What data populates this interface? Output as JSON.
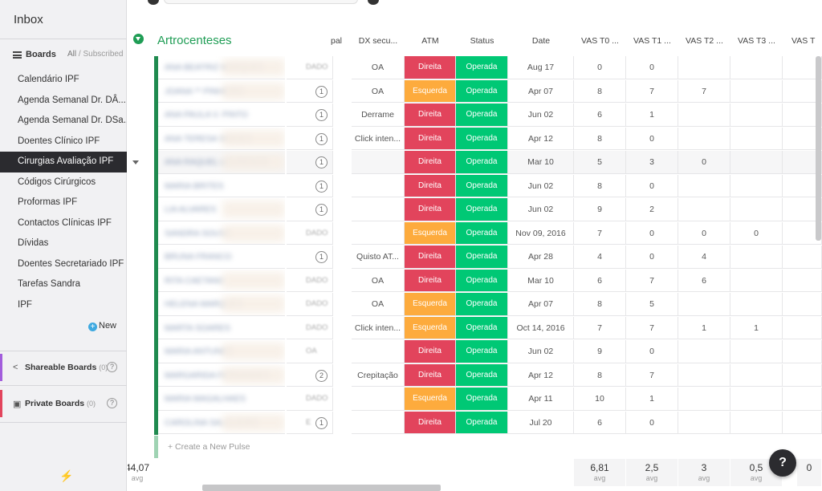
{
  "sidebar": {
    "inbox": "Inbox",
    "boards_label": "Boards",
    "filter_all": "All",
    "filter_sep": " / ",
    "filter_subscribed": "Subscribed",
    "items": [
      "Calendário IPF",
      "Agenda Semanal Dr. DÂ...",
      "Agenda Semanal Dr. DSa...",
      "Doentes Clínico IPF",
      "Cirurgias Avaliação IPF",
      "Códigos Cirúrgicos",
      "Proformas IPF",
      "Contactos Clínicas IPF",
      "Dívidas",
      "Doentes Secretariado IPF",
      "Tarefas Sandra",
      "IPF"
    ],
    "active_index": 4,
    "new_label": "New",
    "shareable": {
      "label": "Shareable Boards",
      "count": "(0)",
      "help": "?"
    },
    "private": {
      "label": "Private Boards",
      "count": "(0)",
      "help": "?"
    },
    "icons": {
      "menu": "menu-icon",
      "share": "share-icon",
      "lock": "lock-icon",
      "bolt": "bolt-icon",
      "plus": "plus-icon"
    }
  },
  "group": {
    "title": "Artrocenteses",
    "color": "#1f9d55"
  },
  "columns": {
    "partial": "pal",
    "dx": "DX secu...",
    "atm": "ATM",
    "status": "Status",
    "date": "Date",
    "vas0": "VAS T0 ...",
    "vas1": "VAS T1 ...",
    "vas2": "VAS T2 ...",
    "vas3": "VAS T3 ...",
    "vas4": "VAS T"
  },
  "rows": [
    {
      "name": "ANA BEATRIZ MARQUES",
      "partial": "DADO",
      "updates": "",
      "dx": "OA",
      "atm": "Direita",
      "status": "Operada",
      "date": "Aug 17",
      "v0": "0",
      "v1": "0",
      "v2": "",
      "v3": ""
    },
    {
      "name": "JOANA ** PINHEIRO",
      "partial": "",
      "updates": "1",
      "dx": "OA",
      "atm": "Esquerda",
      "status": "Operada",
      "date": "Apr 07",
      "v0": "8",
      "v1": "7",
      "v2": "7",
      "v3": ""
    },
    {
      "name": "ANA PAULA V. PINTO",
      "partial": "",
      "updates": "1",
      "dx": "Derrame",
      "atm": "Direita",
      "status": "Operada",
      "date": "Jun 02",
      "v0": "6",
      "v1": "1",
      "v2": "",
      "v3": ""
    },
    {
      "name": "ANA TERESA SIMOES",
      "partial": "",
      "updates": "1",
      "dx": "Click inten...",
      "atm": "Direita",
      "status": "Operada",
      "date": "Apr 12",
      "v0": "8",
      "v1": "0",
      "v2": "",
      "v3": ""
    },
    {
      "name": "ANA RAQUEL LOURENCO",
      "partial": "",
      "updates": "1",
      "dx": "",
      "atm": "Direita",
      "status": "Operada",
      "date": "Mar 10",
      "v0": "5",
      "v1": "3",
      "v2": "0",
      "v3": ""
    },
    {
      "name": "MARIA BRITES",
      "partial": "",
      "updates": "1",
      "dx": "",
      "atm": "Direita",
      "status": "Operada",
      "date": "Jun 02",
      "v0": "8",
      "v1": "0",
      "v2": "",
      "v3": ""
    },
    {
      "name": "LIA ALVARES",
      "partial": "",
      "updates": "1",
      "dx": "",
      "atm": "Direita",
      "status": "Operada",
      "date": "Jun 02",
      "v0": "9",
      "v1": "2",
      "v2": "",
      "v3": ""
    },
    {
      "name": "SANDRA SOUSA",
      "partial": "DADO",
      "updates": "",
      "dx": "",
      "atm": "Esquerda",
      "status": "Operada",
      "date": "Nov 09, 2016",
      "v0": "7",
      "v1": "0",
      "v2": "0",
      "v3": "0"
    },
    {
      "name": "BRUNA FRANCO",
      "partial": "",
      "updates": "1",
      "dx": "Quisto AT...",
      "atm": "Direita",
      "status": "Operada",
      "date": "Apr 28",
      "v0": "4",
      "v1": "0",
      "v2": "4",
      "v3": ""
    },
    {
      "name": "RITA CAETANO",
      "partial": "DADO",
      "updates": "",
      "dx": "OA",
      "atm": "Direita",
      "status": "Operada",
      "date": "Mar 10",
      "v0": "6",
      "v1": "7",
      "v2": "6",
      "v3": ""
    },
    {
      "name": "HELENA MARQUES",
      "partial": "DADO",
      "updates": "",
      "dx": "OA",
      "atm": "Esquerda",
      "status": "Operada",
      "date": "Apr 07",
      "v0": "8",
      "v1": "5",
      "v2": "",
      "v3": ""
    },
    {
      "name": "MARTA SOARES",
      "partial": "DADO",
      "updates": "",
      "dx": "Click inten...",
      "atm": "Esquerda",
      "status": "Operada",
      "date": "Oct 14, 2016",
      "v0": "7",
      "v1": "7",
      "v2": "1",
      "v3": "1"
    },
    {
      "name": "MARIA ANTUNES",
      "partial": "OA",
      "updates": "",
      "dx": "",
      "atm": "Direita",
      "status": "Operada",
      "date": "Jun 02",
      "v0": "9",
      "v1": "0",
      "v2": "",
      "v3": ""
    },
    {
      "name": "MARGARIDA FERNANDES",
      "partial": "",
      "updates": "2",
      "dx": "Crepitação",
      "atm": "Direita",
      "status": "Operada",
      "date": "Apr 12",
      "v0": "8",
      "v1": "7",
      "v2": "",
      "v3": ""
    },
    {
      "name": "MARIA MAGALHAES",
      "partial": "DADO",
      "updates": "",
      "dx": "",
      "atm": "Esquerda",
      "status": "Operada",
      "date": "Apr 11",
      "v0": "10",
      "v1": "1",
      "v2": "",
      "v3": ""
    },
    {
      "name": "CAROLINA SALGUEIRO",
      "partial": "E",
      "updates": "1",
      "dx": "",
      "atm": "Direita",
      "status": "Operada",
      "date": "Jul 20",
      "v0": "6",
      "v1": "0",
      "v2": "",
      "v3": ""
    }
  ],
  "create_pulse": "+ Create a New Pulse",
  "footer": {
    "partial": {
      "value": "44,07",
      "label": "avg"
    },
    "vas0": {
      "value": "6,81",
      "label": "avg"
    },
    "vas1": {
      "value": "2,5",
      "label": "avg"
    },
    "vas2": {
      "value": "3",
      "label": "avg"
    },
    "vas3": {
      "value": "0,5",
      "label": "avg"
    },
    "vas4": {
      "value": "0",
      "label": ""
    }
  },
  "help_label": "?",
  "colors": {
    "green": "#00c875",
    "red": "#e2445c",
    "orange": "#fdab3d",
    "stripe": "#1f8a4f"
  }
}
